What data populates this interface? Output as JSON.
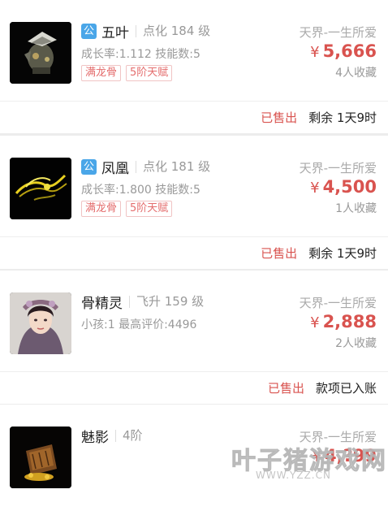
{
  "listings": [
    {
      "public_badge": "公",
      "name": "五叶",
      "level": "点化 184 级",
      "stats": "成长率:1.112  技能数:5",
      "tags": [
        "满龙骨",
        "5阶天赋"
      ],
      "server": "天界-一生所爱",
      "currency": "¥",
      "price": "5,666",
      "favorites": "4人收藏",
      "status": "已售出",
      "remaining": "剩余 1天9时",
      "thumb_icon": "armored-pet-icon"
    },
    {
      "public_badge": "公",
      "name": "凤凰",
      "level": "点化 181 级",
      "stats": "成长率:1.800  技能数:5",
      "tags": [
        "满龙骨",
        "5阶天赋"
      ],
      "server": "天界-一生所爱",
      "currency": "¥",
      "price": "4,500",
      "favorites": "1人收藏",
      "status": "已售出",
      "remaining": "剩余 1天9时",
      "thumb_icon": "golden-phoenix-icon"
    },
    {
      "name": "骨精灵",
      "level": "飞升 159 级",
      "stats": "小孩:1  最高评价:4496",
      "server": "天界-一生所爱",
      "currency": "¥",
      "price": "2,888",
      "favorites": "2人收藏",
      "status": "已售出",
      "remaining": "款项已入账",
      "thumb_icon": "character-portrait-icon"
    },
    {
      "name": "魅影",
      "level": "4阶",
      "server": "天界-一生所爱",
      "currency": "¥",
      "price": "4,?99",
      "thumb_icon": "treasure-item-icon"
    }
  ],
  "watermark": {
    "main": "叶子猪游戏网",
    "sub": "WWW.YZZ.CN"
  },
  "colors": {
    "price": "#d9534f",
    "badge": "#4aa6e8",
    "tag": "#e46d6d",
    "muted": "#999999",
    "background": "#ececec"
  }
}
